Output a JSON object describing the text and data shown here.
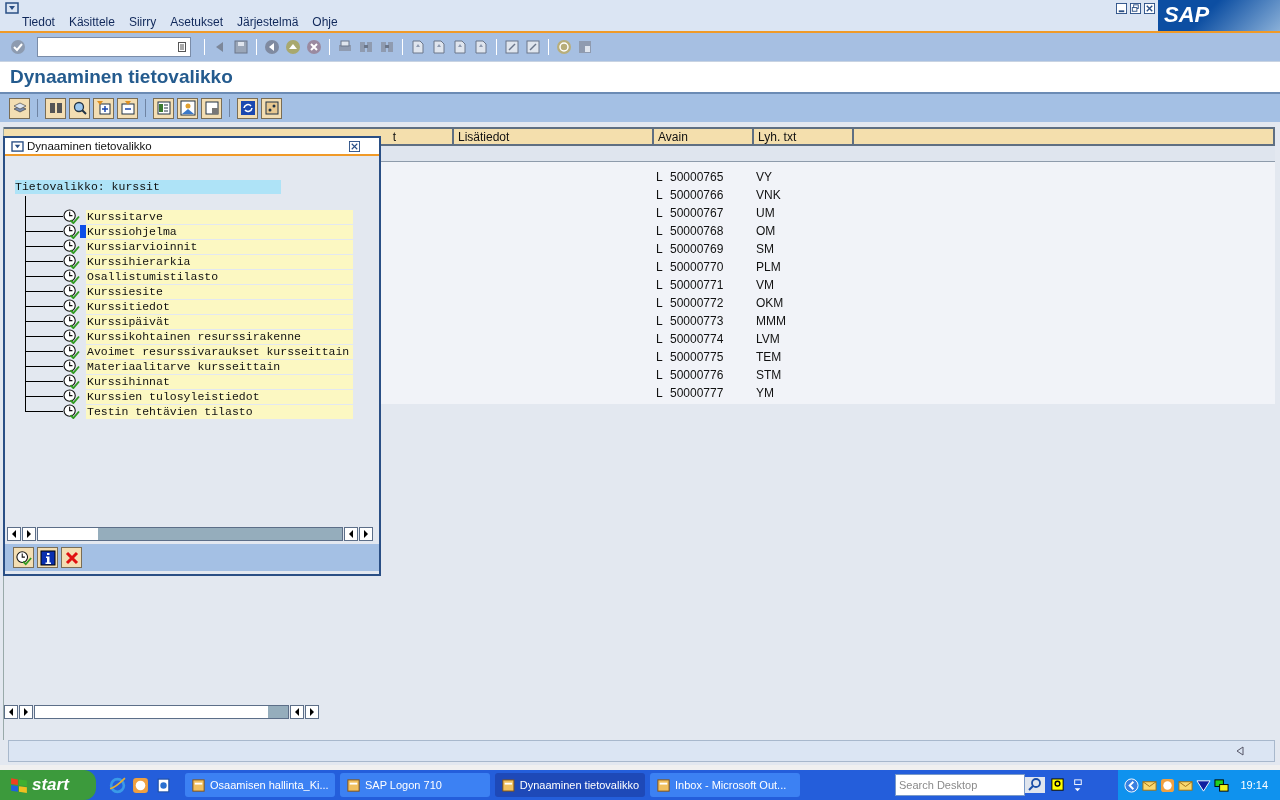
{
  "menu": [
    {
      "label": "Tiedot"
    },
    {
      "label": "Käsittele"
    },
    {
      "label": "Siirry"
    },
    {
      "label": "Asetukset"
    },
    {
      "label": "Järjestelmä"
    },
    {
      "label": "Ohje"
    }
  ],
  "logo": "SAP",
  "title": "Dynaaminen tietovalikko",
  "table": {
    "columns": [
      {
        "label": "t"
      },
      {
        "label": "Lisätiedot"
      },
      {
        "label": "Avain"
      },
      {
        "label": "Lyh. txt"
      }
    ],
    "rows": [
      {
        "type": "L",
        "key": "50000765",
        "short": "VY"
      },
      {
        "type": "L",
        "key": "50000766",
        "short": "VNK"
      },
      {
        "type": "L",
        "key": "50000767",
        "short": "UM"
      },
      {
        "type": "L",
        "key": "50000768",
        "short": "OM"
      },
      {
        "type": "L",
        "key": "50000769",
        "short": "SM"
      },
      {
        "type": "L",
        "key": "50000770",
        "short": "PLM"
      },
      {
        "type": "L",
        "key": "50000771",
        "short": "VM"
      },
      {
        "type": "L",
        "key": "50000772",
        "short": "OKM"
      },
      {
        "type": "L",
        "key": "50000773",
        "short": "MMM"
      },
      {
        "type": "L",
        "key": "50000774",
        "short": "LVM"
      },
      {
        "type": "L",
        "key": "50000775",
        "short": "TEM"
      },
      {
        "type": "L",
        "key": "50000776",
        "short": "STM"
      },
      {
        "type": "L",
        "key": "50000777",
        "short": "YM"
      }
    ]
  },
  "dialog": {
    "title": "Dynaaminen tietovalikko",
    "root": "Tietovalikko: kurssit",
    "items": [
      {
        "label": "Kurssitarve",
        "selected": false
      },
      {
        "label": "Kurssiohjelma",
        "selected": true
      },
      {
        "label": "Kurssiarvioinnit",
        "selected": false
      },
      {
        "label": "Kurssihierarkia",
        "selected": false
      },
      {
        "label": "Osallistumistilasto",
        "selected": false
      },
      {
        "label": "Kurssiesite",
        "selected": false
      },
      {
        "label": "Kurssitiedot",
        "selected": false
      },
      {
        "label": "Kurssipäivät",
        "selected": false
      },
      {
        "label": "Kurssikohtainen resurssirakenne",
        "selected": false
      },
      {
        "label": "Avoimet resurssivaraukset kursseittain",
        "selected": false
      },
      {
        "label": "Materiaalitarve kursseittain",
        "selected": false
      },
      {
        "label": "Kurssihinnat",
        "selected": false
      },
      {
        "label": "Kurssien tulosyleistiedot",
        "selected": false
      },
      {
        "label": "Testin tehtävien tilasto",
        "selected": false
      }
    ]
  },
  "taskbar": {
    "start": "start",
    "tasks": [
      {
        "label": "Osaamisen hallinta_Ki...",
        "selected": false
      },
      {
        "label": "SAP Logon 710",
        "selected": false
      },
      {
        "label": "Dynaaminen tietovalikko",
        "selected": true
      },
      {
        "label": "Inbox - Microsoft Out...",
        "selected": false
      }
    ],
    "search": {
      "placeholder": "Search Desktop"
    },
    "clock": "19:14"
  }
}
